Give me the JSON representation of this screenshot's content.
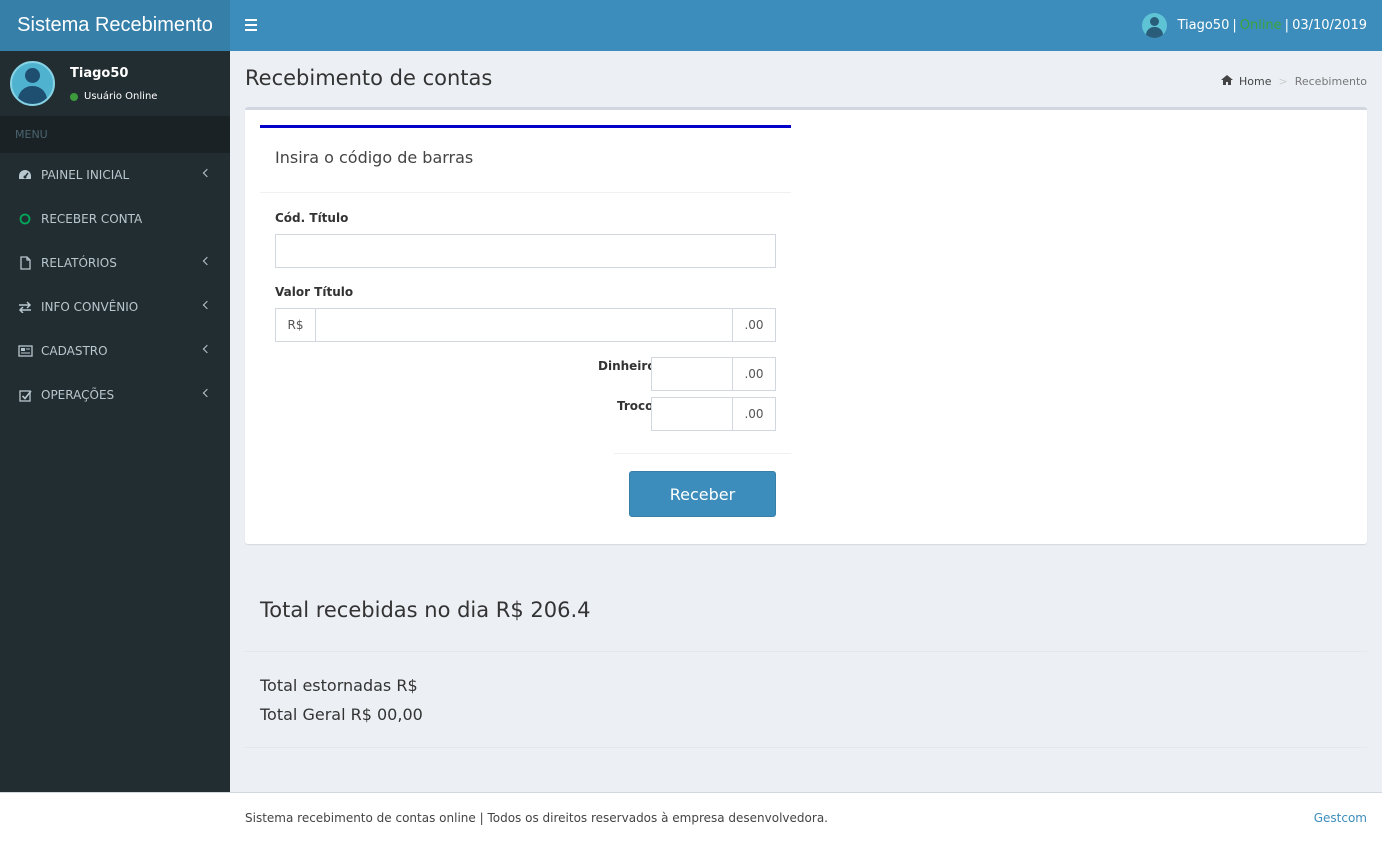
{
  "app": {
    "title": "Sistema Recebimento"
  },
  "header": {
    "user": "Tiago50",
    "separator": "|",
    "status": "Online",
    "date": "03/10/2019"
  },
  "sidebar": {
    "user_name": "Tiago50",
    "user_status": "Usuário Online",
    "menu_header": "MENU",
    "items": [
      {
        "label": "PAINEL INICIAL",
        "icon": "dashboard-icon"
      },
      {
        "label": "RECEBER CONTA",
        "icon": "circle-icon"
      },
      {
        "label": "RELATÓRIOS",
        "icon": "file-icon"
      },
      {
        "label": "INFO CONVÊNIO",
        "icon": "exchange-icon"
      },
      {
        "label": "CADASTRO",
        "icon": "newspaper-icon"
      },
      {
        "label": "OPERAÇÕES",
        "icon": "check-square-icon"
      }
    ]
  },
  "page": {
    "title": "Recebimento de contas"
  },
  "breadcrumb": {
    "home": "Home",
    "current": "Recebimento"
  },
  "form": {
    "heading": "Insira o código de barras",
    "cod_label": "Cód. Título",
    "cod_value": "",
    "valor_label": "Valor Título",
    "currency": "R$",
    "cents": ".00",
    "valor_value": "",
    "dinheiro_label": "Dinheiro",
    "dinheiro_value": "",
    "troco_label": "Troco",
    "troco_value": "",
    "submit": "Receber"
  },
  "totals": {
    "day": "Total recebidas no dia R$ 206.4",
    "estornadas": "Total estornadas R$",
    "geral": "Total Geral R$ 00,00"
  },
  "footer": {
    "text_left": "Sistema recebimento de contas online",
    "separator": "|",
    "text_right": "Todos os direitos reservados à empresa desenvolvedora.",
    "link": "Gestcom"
  },
  "colors": {
    "accent": "#3c8dbc",
    "sidebar": "#222d32",
    "online": "#39a43b",
    "form_bar": "#0000c8"
  }
}
